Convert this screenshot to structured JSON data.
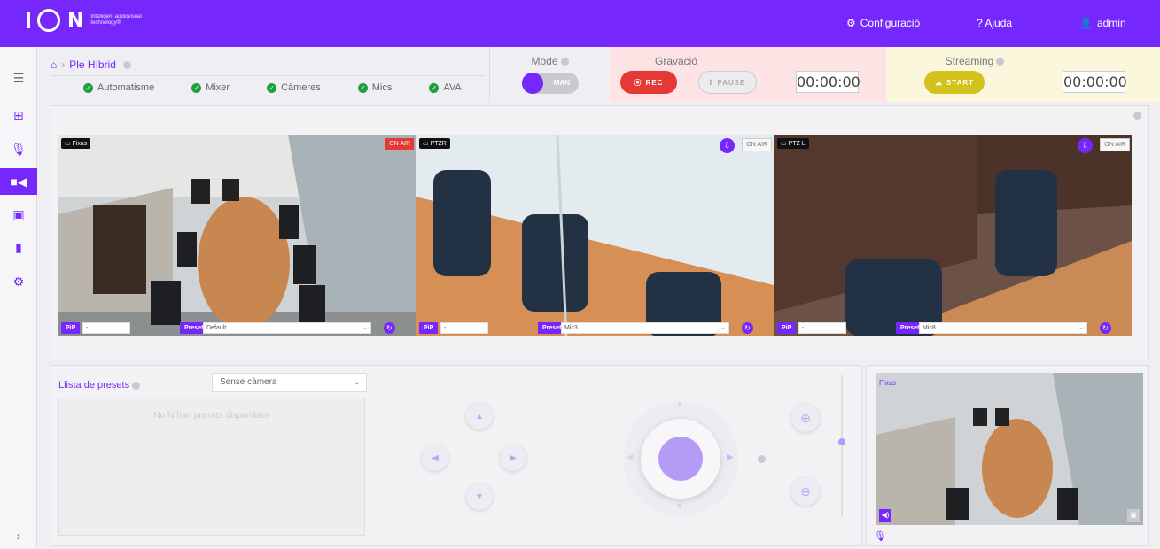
{
  "app": {
    "logo_text": "N",
    "tagline": "Intelligent audiovisual technology®"
  },
  "topnav": {
    "config": "Configuració",
    "help": "? Ajuda",
    "user": "admin"
  },
  "colors": {
    "accent": "#7627fb",
    "ok": "#1c9f3c",
    "rec": "#e53935",
    "stream": "#d4c11a"
  },
  "breadcrumb": {
    "title": "Ple Híbrid"
  },
  "status": [
    "Automatisme",
    "Mixer",
    "Càmeres",
    "Mics",
    "AVA"
  ],
  "mode": {
    "title": "Mode",
    "value": "MAN"
  },
  "recording": {
    "title": "Gravació",
    "rec": "REC",
    "pause": "PAUSE",
    "time": "00:00:00"
  },
  "streaming": {
    "title": "Streaming",
    "start": "START",
    "time": "00:00:00"
  },
  "cameras": [
    {
      "name": "Fixas",
      "on_air": "ON AIR",
      "pip_label": "PiP",
      "pip_value": "-",
      "preset_label": "Preset",
      "preset_value": "Default"
    },
    {
      "name": "PTZR",
      "on_air": "ON AIR",
      "pip_label": "PiP",
      "pip_value": "-",
      "preset_label": "Preset",
      "preset_value": "Mic3"
    },
    {
      "name": "PTZ L",
      "on_air": "ON AIR",
      "pip_label": "PiP",
      "pip_value": "-",
      "preset_label": "Preset",
      "preset_value": "Mic8"
    }
  ],
  "presets": {
    "title": "Llista de presets",
    "camera_select": "Sense càmera",
    "empty": "No hi han presets disponibles"
  },
  "preview": {
    "label": "Fixas"
  }
}
